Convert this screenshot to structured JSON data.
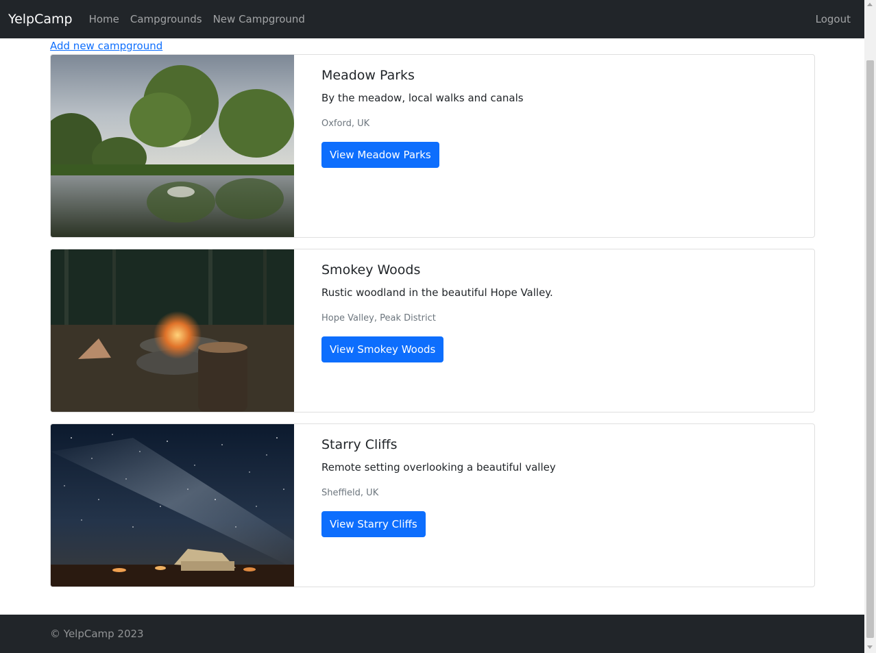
{
  "navbar": {
    "brand": "YelpCamp",
    "links": [
      "Home",
      "Campgrounds",
      "New Campground"
    ],
    "logout": "Logout"
  },
  "add_link": "Add new campground",
  "campgrounds": [
    {
      "title": "Meadow Parks",
      "description": "By the meadow, local walks and canals",
      "location": "Oxford, UK",
      "button": "View Meadow Parks"
    },
    {
      "title": "Smokey Woods",
      "description": "Rustic woodland in the beautiful Hope Valley.",
      "location": "Hope Valley, Peak District",
      "button": "View Smokey Woods"
    },
    {
      "title": "Starry Cliffs",
      "description": "Remote setting overlooking a beautiful valley",
      "location": "Sheffield, UK",
      "button": "View Starry Cliffs"
    }
  ],
  "footer": "© YelpCamp 2023",
  "colors": {
    "navbar_bg": "#212529",
    "primary": "#0d6efd",
    "muted": "#6c757d"
  }
}
